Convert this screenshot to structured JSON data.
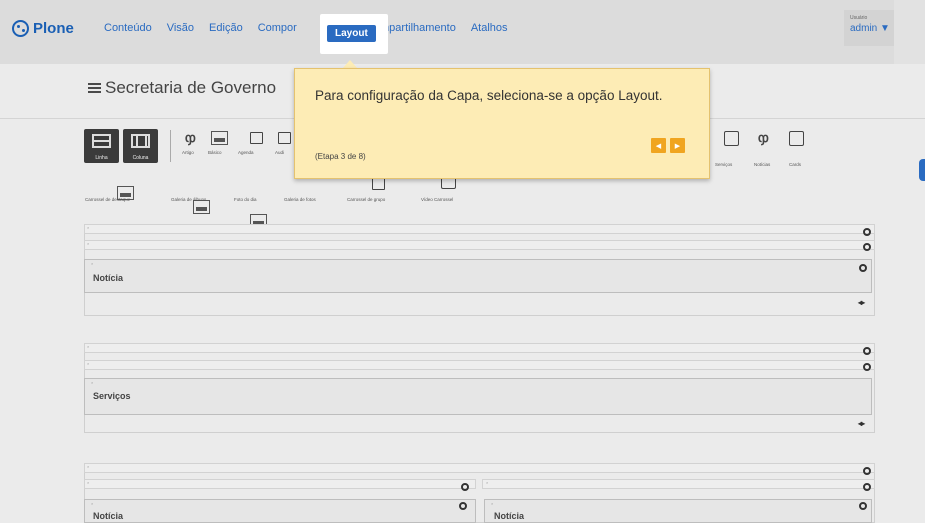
{
  "toolbar": {
    "brand": "Plone",
    "nav": [
      "Conteúdo",
      "Visão",
      "Edição",
      "Compor"
    ],
    "nav_active": "Layout",
    "nav_after": [
      "Compartilhamento",
      "Atalhos"
    ],
    "user_label": "Usuário",
    "user_name": "admin ▼"
  },
  "page": {
    "title": "Secretaria de Governo"
  },
  "palette": {
    "linha_label": "Linha",
    "coluna_label": "Coluna",
    "row1_captions": [
      "Artigo",
      "Básico",
      "Agenda",
      "Audi"
    ],
    "right_captions": [
      "Serviços",
      "Notícias",
      "Cards"
    ],
    "row2_captions": [
      "Carrossel de destaque",
      "Galeria de álbuns",
      "Foto do dia",
      "Galeria de fotos",
      "Carrossel de grupo",
      "Vídeo Carrossel"
    ]
  },
  "tour": {
    "text": "Para configuração da Capa, seleciona-se a opção Layout.",
    "step": "(Etapa 3 de 8)",
    "prev_icon": "chevron-left-icon",
    "next_icon": "chevron-right-icon",
    "bg_color": "#fdecb5",
    "button_color": "#f0a520"
  },
  "layout_tiles": {
    "tile1": "Notícia",
    "tile2": "Serviços",
    "tile3": "Notícia",
    "tile4": "Notícia"
  },
  "colors": {
    "accent": "#2a6bc1"
  }
}
